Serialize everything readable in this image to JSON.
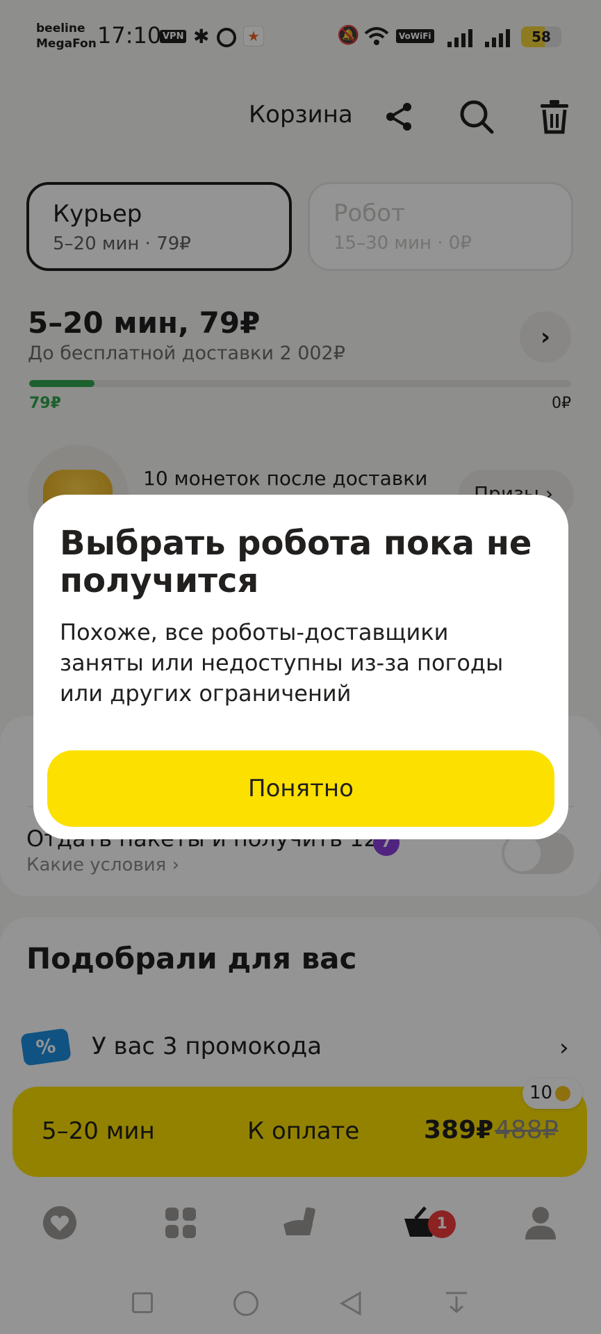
{
  "status_bar": {
    "carrier_1": "beeline",
    "carrier_2": "MegaFon",
    "time": "17:10",
    "vpn": "VPN",
    "vowifi": "VoWiFi",
    "battery": "58",
    "battery_level": 0.58
  },
  "header": {
    "title": "Корзина"
  },
  "delivery_tabs": [
    {
      "title": "Курьер",
      "sub": "5–20 мин · 79₽"
    },
    {
      "title": "Робот",
      "sub": "15–30 мин · 0₽"
    }
  ],
  "delivery": {
    "title": "5–20 мин, 79₽",
    "sub": "До бесплатной доставки 2 002₽",
    "progress_left": "79₽",
    "progress_right": "0₽",
    "progress": 0.12
  },
  "coins": {
    "text": "10 монеток после доставки",
    "prizes": "Призы"
  },
  "bags": {
    "title": "Отдать пакеты и получить 12",
    "badge": "7",
    "sub": "Какие условия"
  },
  "recommend": {
    "title": "Подобрали для вас"
  },
  "promo": {
    "icon": "%",
    "text": "У вас 3 промокода"
  },
  "pay": {
    "time": "5–20 мин",
    "label": "К оплате",
    "price": "389₽",
    "old_price": "488₽",
    "coins": "10"
  },
  "tabbar": {
    "cart_badge": "1"
  },
  "dialog": {
    "title": "Выбрать робота пока не получится",
    "text": "Похоже, все роботы-доставщики заняты или недоступны из-за погоды или других ограничений",
    "button": "Понятно"
  },
  "colors": {
    "accent": "#fce000",
    "green": "#2fa84f",
    "badge_red": "#f23c3c"
  }
}
